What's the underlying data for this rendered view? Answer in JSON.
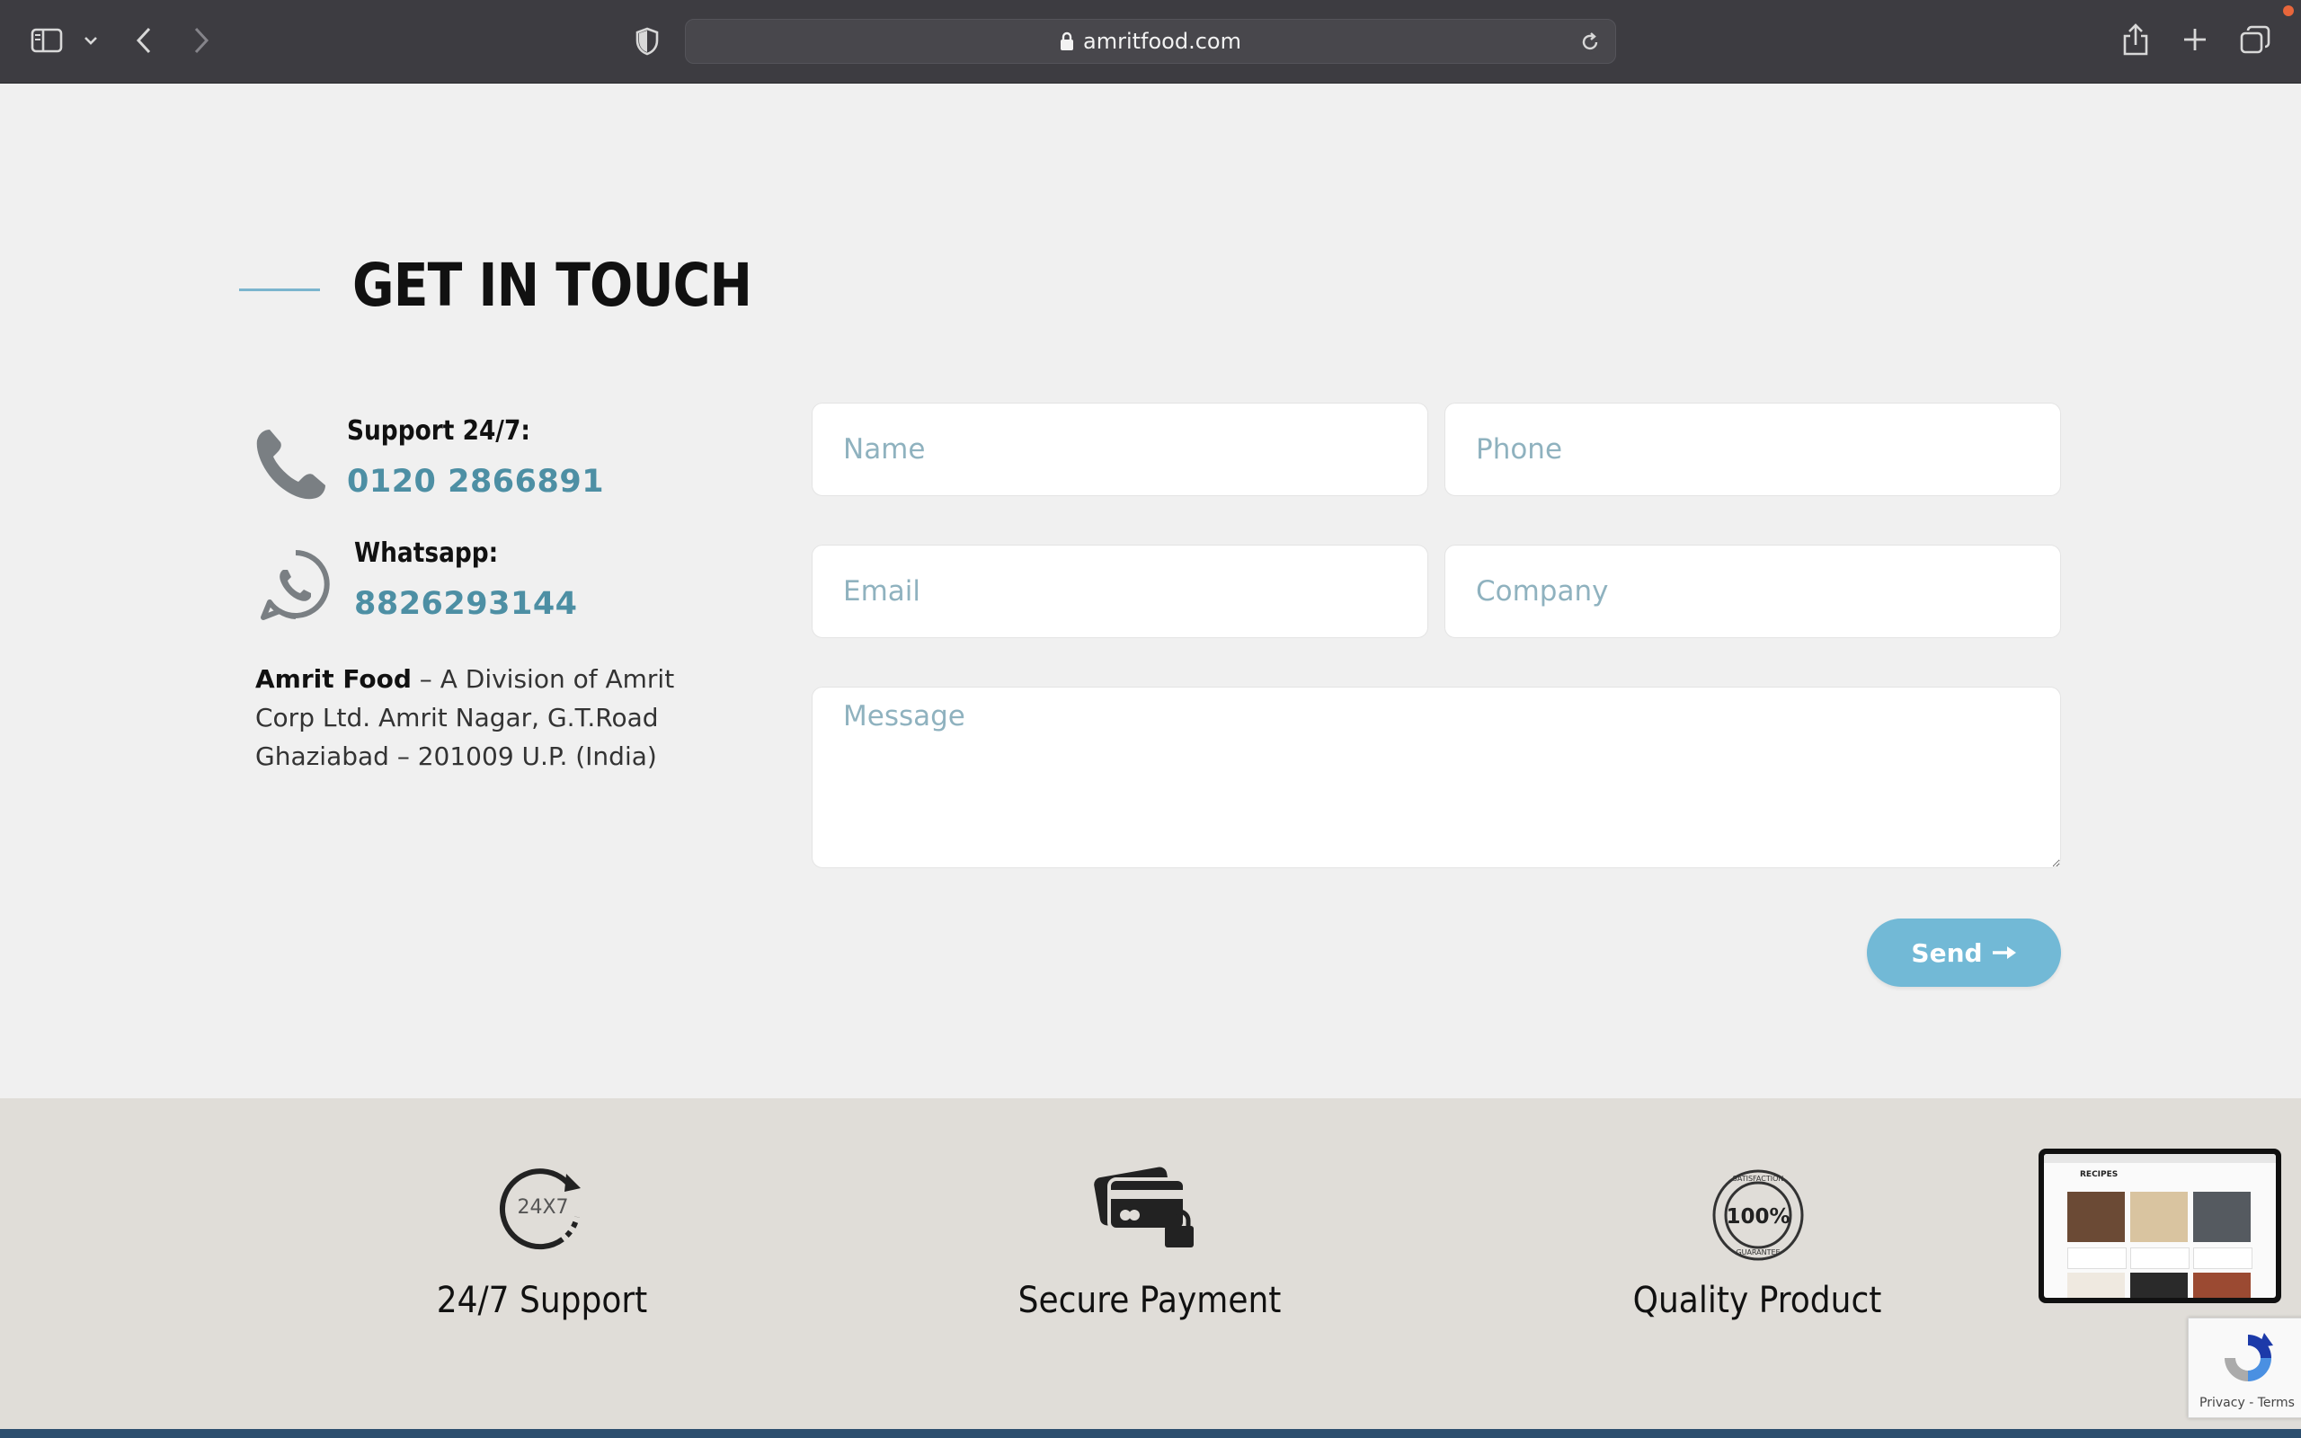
{
  "browser": {
    "url": "amritfood.com"
  },
  "contact": {
    "title": "GET IN TOUCH",
    "support_label": "Support 24/7:",
    "support_phone": "0120 2866891",
    "whatsapp_label": "Whatsapp:",
    "whatsapp_number": "8826293144",
    "address_company": "Amrit Food",
    "address_line1": " – A Division of Amrit",
    "address_line2": "Corp Ltd. Amrit Nagar, G.T.Road",
    "address_line3": "Ghaziabad – 201009 U.P. (India)"
  },
  "form": {
    "name_placeholder": "Name",
    "phone_placeholder": "Phone",
    "email_placeholder": "Email",
    "company_placeholder": "Company",
    "message_placeholder": "Message",
    "send_label": "Send"
  },
  "features": [
    {
      "title": "24/7 Support",
      "icon": "24x7-clock-icon",
      "icon_text": "24X7"
    },
    {
      "title": "Secure Payment",
      "icon": "secure-card-lock-icon"
    },
    {
      "title": "Quality Product",
      "icon": "satisfaction-guarantee-badge-icon",
      "icon_text": "100%",
      "ring_top": "SATISFACTION",
      "ring_bottom": "GUARANTEE"
    }
  ],
  "thumbnail": {
    "heading": "RECIPES"
  },
  "recaptcha": {
    "privacy": "Privacy",
    "separator": " - ",
    "terms": "Terms"
  },
  "colors": {
    "accent": "#4d8fa4",
    "button": "#72b9d6",
    "page_bg": "#f0f0f0",
    "band_bg": "#e0ddd8"
  }
}
